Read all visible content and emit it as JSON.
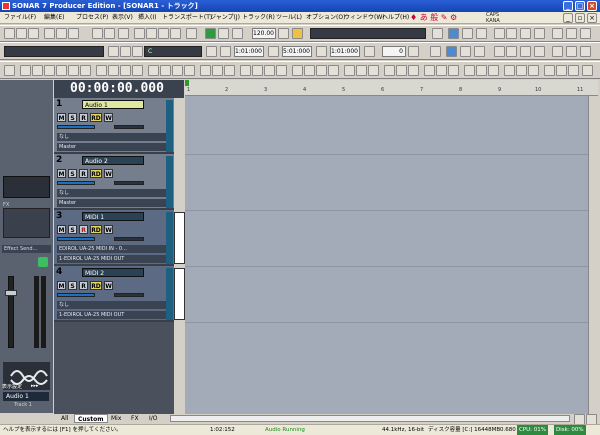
{
  "window": {
    "title": "SONAR 7 Producer Edition - [SONAR1 - トラック]"
  },
  "menubar": {
    "items": [
      "ファイル(F)",
      "編集(E)",
      "プロセス(P)",
      "表示(V)",
      "挿入(I)",
      "トランスポート(T)",
      "ジャンプ(J)",
      "トラック(R)",
      "ツール(L)",
      "オプション(O)",
      "ウィンドウ(W)",
      "ヘルプ(H)"
    ],
    "ime": [
      "CAPS",
      "KANA"
    ]
  },
  "toolbar": {
    "tempo": "120.00",
    "marker_start": "1:01:000",
    "marker_end": "5:01:000",
    "counter": "1:01:000",
    "offset": "0",
    "preset": "C"
  },
  "clock": "00:00:00.000",
  "ruler": {
    "marks": [
      "1",
      "2",
      "3",
      "4",
      "5",
      "6",
      "7",
      "8",
      "9",
      "10",
      "11"
    ]
  },
  "tracks": [
    {
      "num": "1",
      "name": "Audio 1",
      "type": "audio",
      "buttons": [
        "M",
        "S",
        "R",
        "RD",
        "W"
      ],
      "input": "なし",
      "output": "Master",
      "selected": true
    },
    {
      "num": "2",
      "name": "Audio 2",
      "type": "audio",
      "buttons": [
        "M",
        "S",
        "R",
        "RD",
        "W"
      ],
      "input": "なし",
      "output": "Master",
      "selected": false
    },
    {
      "num": "3",
      "name": "MIDI 1",
      "type": "midi",
      "buttons": [
        "M",
        "S",
        "R",
        "RD",
        "W"
      ],
      "input": "EDIROL UA-25 MIDI IN - 0…",
      "output": "1-EDIROL UA-25 MIDI OUT",
      "selected": false
    },
    {
      "num": "4",
      "name": "MIDI 2",
      "type": "midi",
      "buttons": [
        "M",
        "S",
        "R",
        "RD",
        "W"
      ],
      "input": "なし",
      "output": "1-EDIROL UA-25 MIDI OUT",
      "selected": false
    }
  ],
  "leftpanel": {
    "fx_label": "FX",
    "effect_send": "Effect Send...",
    "display_settings": "表示設定",
    "track_name": "Audio 1",
    "track_label": "Track 1"
  },
  "bottomtabs": [
    "All",
    "Custom",
    "Mix",
    "FX",
    "I/O"
  ],
  "status": {
    "help": "ヘルプを表示するには [F1] を押してください。",
    "time": "1:02:152",
    "audio": "Audio Running",
    "format": "44.1kHz, 16-bit",
    "disk": "ディスク容量 [C:] 16448MB",
    "latency": "0.680",
    "cpu": "CPU: 01%",
    "diskload": "Disk: 00%"
  },
  "colors": {
    "title": "#1545b4",
    "track_bg": "#747e8c",
    "midi_bg": "#5c6b83",
    "clip_bg": "#a3abb8",
    "status_green": "#1a8a1a"
  }
}
